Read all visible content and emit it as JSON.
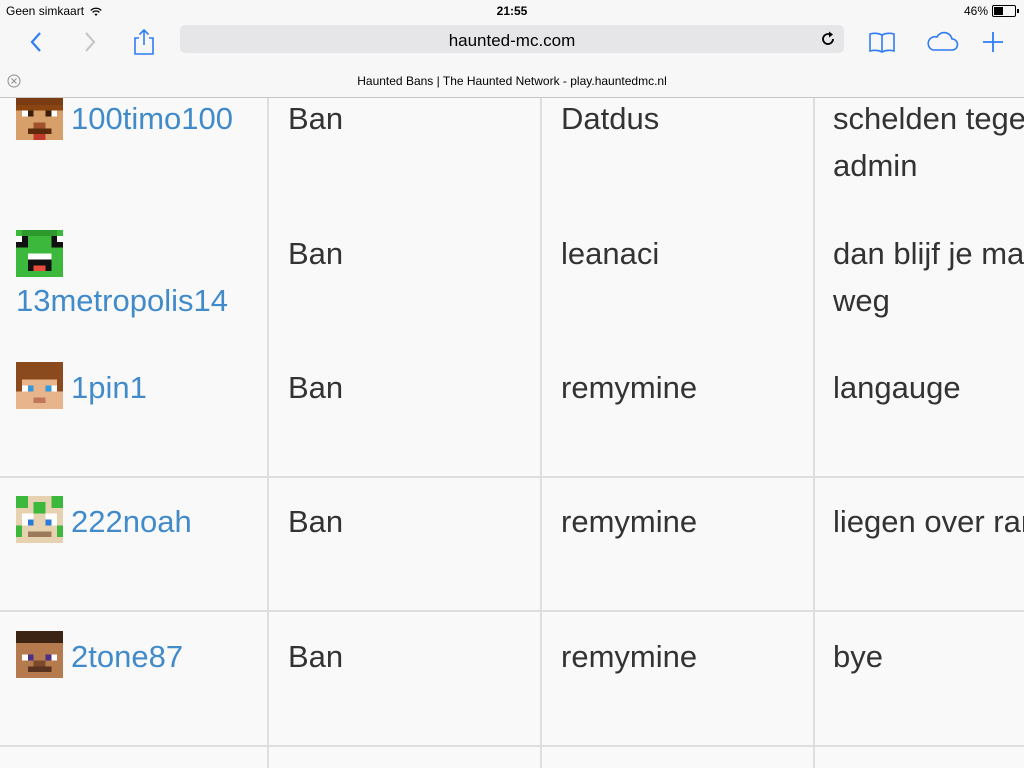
{
  "status_bar": {
    "carrier": "Geen simkaart",
    "time": "21:55",
    "battery": "46%",
    "battery_level": 0.46
  },
  "browser": {
    "url": "haunted-mc.com",
    "tab_title": "Haunted Bans | The Haunted Network - play.hauntedmc.nl",
    "icons": [
      "back-icon",
      "forward-icon",
      "share-icon",
      "reload-icon",
      "bookmarks-icon",
      "icloud-tabs-icon",
      "new-tab-icon",
      "close-tab-icon"
    ]
  },
  "bans": {
    "rows": [
      {
        "player": "100timo100",
        "type": "Ban",
        "by": "Datdus",
        "reason": "schelden tegen admin",
        "avatar": "skin-orange-face"
      },
      {
        "player": "13metropolis14",
        "type": "Ban",
        "by": "leanaci",
        "reason": "dan blijf je maar weg",
        "avatar": "skin-green-creeper"
      },
      {
        "player": "1pin1",
        "type": "Ban",
        "by": "remymine",
        "reason": "langauge",
        "avatar": "skin-brown-hair"
      },
      {
        "player": "222noah",
        "type": "Ban",
        "by": "remymine",
        "reason": "liegen over rank",
        "avatar": "skin-green-white"
      },
      {
        "player": "2tone87",
        "type": "Ban",
        "by": "remymine",
        "reason": "bye",
        "avatar": "skin-steve"
      },
      {
        "player": "",
        "type": "",
        "by": "",
        "reason": "",
        "avatar": ""
      }
    ]
  },
  "colors": {
    "link": "#428bca",
    "text": "#333333",
    "accent": "#2f7cf6"
  }
}
